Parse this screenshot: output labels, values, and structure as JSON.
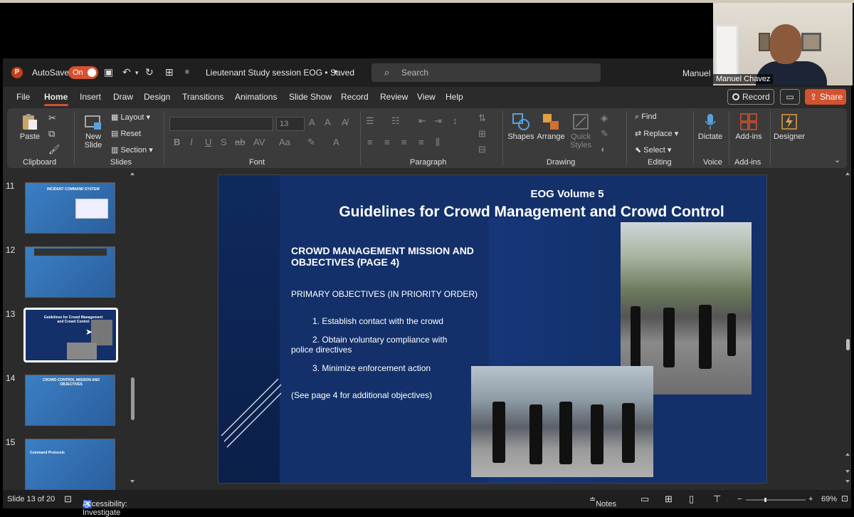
{
  "titlebar": {
    "autosave_label": "AutoSave",
    "autosave_state": "On",
    "doc_title": "Lieutenant Study session EOG • Saved",
    "search_placeholder": "Search",
    "user": "Manuel"
  },
  "menu": {
    "items": [
      "File",
      "Home",
      "Insert",
      "Draw",
      "Design",
      "Transitions",
      "Animations",
      "Slide Show",
      "Record",
      "Review",
      "View",
      "Help"
    ],
    "active": "Home",
    "record_label": "Record",
    "share_label": "Share"
  },
  "ribbon": {
    "clipboard": {
      "paste": "Paste",
      "label": "Clipboard"
    },
    "slides": {
      "new_slide": "New",
      "new_slide2": "Slide",
      "layout": "Layout",
      "reset": "Reset",
      "section": "Section",
      "label": "Slides"
    },
    "font": {
      "size": "13",
      "label": "Font"
    },
    "paragraph": {
      "label": "Paragraph"
    },
    "drawing": {
      "shapes": "Shapes",
      "arrange": "Arrange",
      "quick_styles": "Quick",
      "quick_styles2": "Styles",
      "label": "Drawing"
    },
    "editing": {
      "find": "Find",
      "replace": "Replace",
      "select": "Select",
      "label": "Editing"
    },
    "voice": {
      "dictate": "Dictate",
      "label": "Voice"
    },
    "addins": {
      "addins": "Add-ins",
      "label": "Add-ins"
    },
    "designer": {
      "designer": "Designer"
    }
  },
  "thumbnails": [
    {
      "num": "11",
      "title": "INCIDENT COMMAND SYSTEM"
    },
    {
      "num": "12",
      "title": ""
    },
    {
      "num": "13",
      "title": "Guidelines for Crowd Management and Crowd Control"
    },
    {
      "num": "14",
      "title": "CROWD CONTROL MISSION AND OBJECTIVES"
    },
    {
      "num": "15",
      "title": "Command Protocols"
    }
  ],
  "slide": {
    "top_line": "EOG Volume 5",
    "title": "Guidelines for Crowd Management and Crowd Control",
    "heading": "CROWD MANAGEMENT MISSION AND OBJECTIVES (PAGE 4)",
    "primary": "PRIMARY OBJECTIVES (IN PRIORITY ORDER)",
    "obj1": "1. Establish contact with the crowd",
    "obj2a": "2. Obtain voluntary compliance with",
    "obj2b": "police directives",
    "obj3": "3. Minimize enforcement action",
    "note": "(See page 4 for additional objectives)"
  },
  "statusbar": {
    "slide_count": "Slide 13 of 20",
    "accessibility": "Accessibility: Investigate",
    "notes": "Notes",
    "zoom": "69%"
  },
  "webcam": {
    "name": "Manuel Chavez"
  },
  "colors": {
    "accent": "#d35230",
    "slide_bg": "#13306a"
  }
}
